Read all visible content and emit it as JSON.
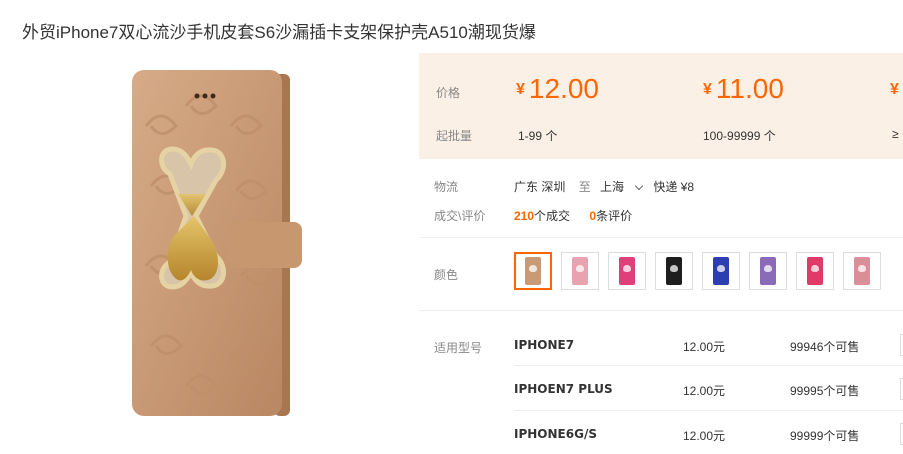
{
  "title": "外贸iPhone7双心流沙手机皮套S6沙漏插卡支架保护壳A510潮现货爆",
  "price": {
    "price_label": "价格",
    "moq_label": "起批量",
    "tiers": [
      {
        "currency": "¥",
        "amount": "12.00",
        "range": "1-99 个"
      },
      {
        "currency": "¥",
        "amount": "11.00",
        "range": "100-99999 个"
      },
      {
        "currency": "¥",
        "amount": "",
        "range": "≥"
      }
    ]
  },
  "logistics": {
    "label": "物流",
    "origin": "广东 深圳",
    "to_word": "至",
    "destination": "上海",
    "shipping": "快递 ¥8"
  },
  "deals": {
    "label": "成交\\评价",
    "count": "210",
    "count_unit": "个成交",
    "reviews": "0",
    "reviews_unit": "条评价"
  },
  "colors": {
    "label": "颜色",
    "swatches": [
      "#c99a76",
      "#e8a3b1",
      "#e0407a",
      "#1e1e1e",
      "#2c3fb0",
      "#8a6bb8",
      "#e03a68",
      "#d98f98"
    ]
  },
  "models": {
    "label": "适用型号",
    "rows": [
      {
        "name": "IPHONE7",
        "price": "12.00元",
        "stock": "99946个可售"
      },
      {
        "name": "IPHOEN7 PLUS",
        "price": "12.00元",
        "stock": "99995个可售"
      },
      {
        "name": "IPHONE6G/S",
        "price": "12.00元",
        "stock": "99999个可售"
      }
    ]
  }
}
